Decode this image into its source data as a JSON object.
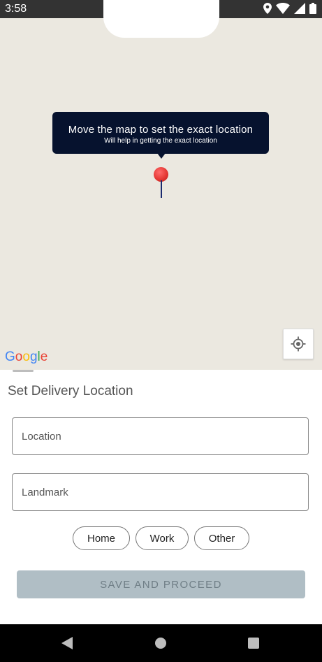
{
  "status_bar": {
    "time": "3:58",
    "icons": [
      "location-icon",
      "wifi-icon",
      "signal-icon",
      "battery-icon"
    ]
  },
  "map": {
    "tooltip_title": "Move the map to set the exact location",
    "tooltip_subtitle": "Will help in getting the exact location",
    "attribution": "Google",
    "pin_color": "#e53935",
    "background_color": "#ebe8e0"
  },
  "sheet": {
    "title": "Set Delivery Location",
    "location_placeholder": "Location",
    "landmark_placeholder": "Landmark",
    "chips": {
      "home": "Home",
      "work": "Work",
      "other": "Other"
    },
    "save_label": "SAVE AND PROCEED",
    "save_color": "#b0bec5"
  },
  "navbar": {
    "icons": [
      "back-icon",
      "home-icon",
      "recents-icon"
    ]
  }
}
